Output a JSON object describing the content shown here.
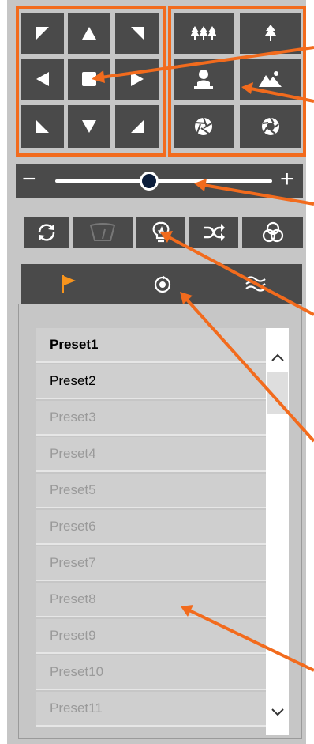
{
  "colors": {
    "panel": "#c6c6c6",
    "button": "#4a4a4a",
    "accent": "#f26b1d",
    "icon": "#ffffff"
  },
  "ptz_pad": {
    "icons": [
      "arrow-up-left-icon",
      "arrow-up-icon",
      "arrow-up-right-icon",
      "arrow-left-icon",
      "stop-icon",
      "arrow-right-icon",
      "arrow-down-left-icon",
      "arrow-down-icon",
      "arrow-down-right-icon"
    ]
  },
  "scene_buttons": {
    "icons": [
      "forest-icon",
      "tree-icon",
      "person-icon",
      "mountain-icon",
      "aperture-close-icon",
      "aperture-open-icon"
    ]
  },
  "zoom_slider": {
    "minus_label": "−",
    "plus_label": "+",
    "level": 0.52
  },
  "toolbar": {
    "icons": [
      "refresh-icon",
      "wiper-icon",
      "light-bulb-icon",
      "shuffle-icon",
      "color-circles-icon"
    ]
  },
  "tabs": [
    {
      "icon": "flag-icon",
      "active": true
    },
    {
      "icon": "patrol-icon",
      "active": false
    },
    {
      "icon": "waves-icon",
      "active": false
    }
  ],
  "presets": [
    {
      "label": "Preset1",
      "state": "bold"
    },
    {
      "label": "Preset2",
      "state": "active"
    },
    {
      "label": "Preset3",
      "state": "inactive"
    },
    {
      "label": "Preset4",
      "state": "inactive"
    },
    {
      "label": "Preset5",
      "state": "inactive"
    },
    {
      "label": "Preset6",
      "state": "inactive"
    },
    {
      "label": "Preset7",
      "state": "inactive"
    },
    {
      "label": "Preset8",
      "state": "inactive"
    },
    {
      "label": "Preset9",
      "state": "inactive"
    },
    {
      "label": "Preset10",
      "state": "inactive"
    },
    {
      "label": "Preset11",
      "state": "inactive"
    }
  ],
  "scroll": {
    "up_icon": "chevron-up-icon",
    "down_icon": "chevron-down-icon"
  }
}
